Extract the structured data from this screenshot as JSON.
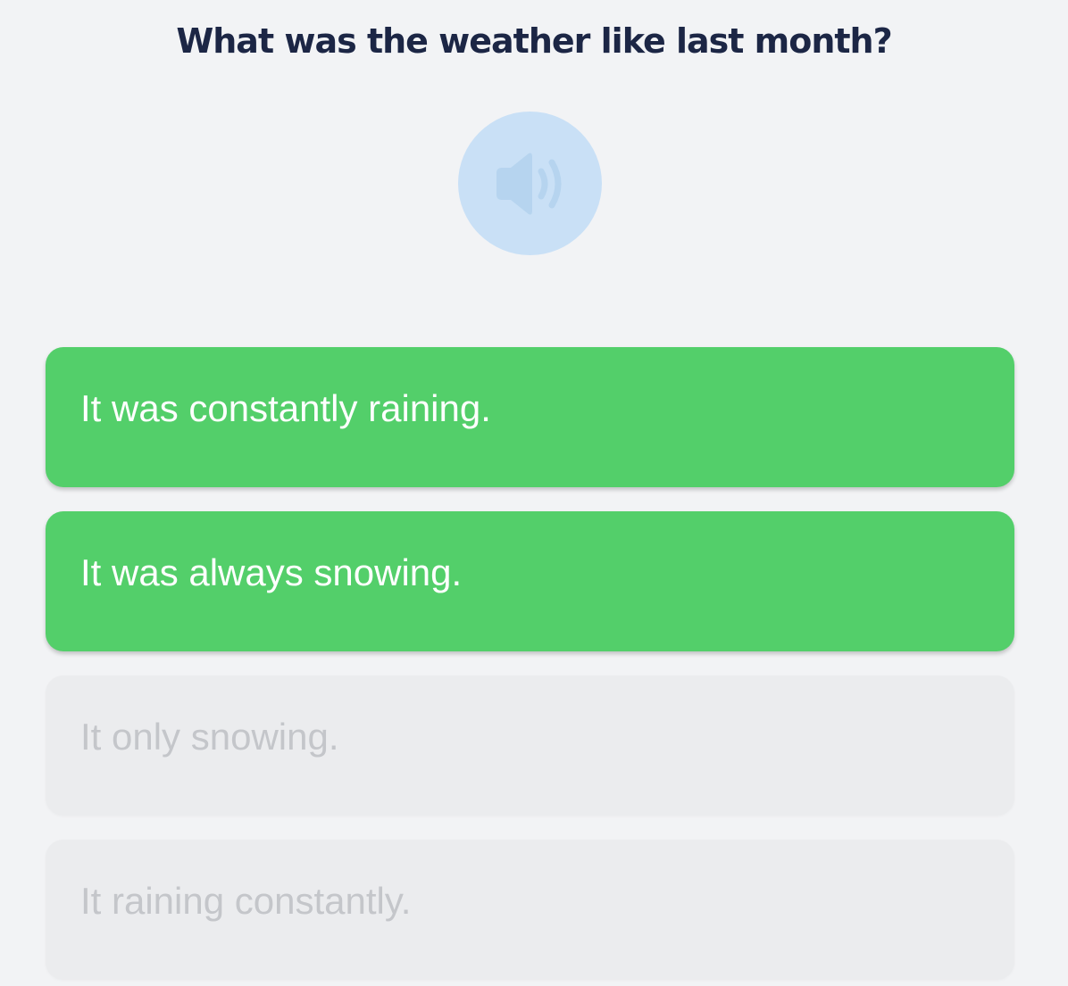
{
  "question": "What was the weather like last month?",
  "audio_button": {
    "icon": "speaker-icon",
    "color": "#c9e0f6",
    "icon_color": "#b6d4ef"
  },
  "options": [
    {
      "label": "It was constantly raining.",
      "state": "selected"
    },
    {
      "label": "It was always snowing.",
      "state": "selected"
    },
    {
      "label": "It only snowing.",
      "state": "disabled"
    },
    {
      "label": "It raining constantly.",
      "state": "disabled"
    }
  ],
  "colors": {
    "background": "#f2f3f5",
    "question_text": "#1c2645",
    "selected": "#53cf6a",
    "selected_text": "#ffffff",
    "disabled": "#ebecee",
    "disabled_text": "#c4c6ca"
  }
}
